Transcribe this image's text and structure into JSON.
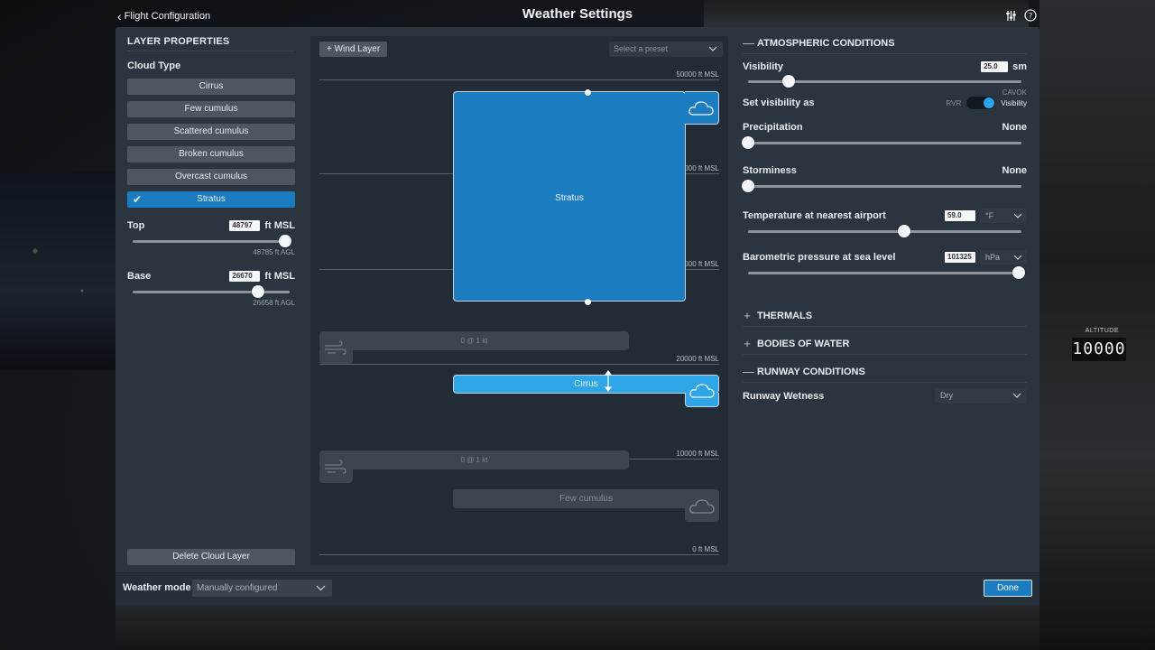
{
  "topbar": {
    "back_label": "Flight Configuration",
    "title": "Weather Settings",
    "icons": [
      "sliders-icon",
      "help-icon"
    ]
  },
  "background": {
    "altitude_label": "ALTITUDE",
    "altitude_value": "10000"
  },
  "layer_properties": {
    "title": "LAYER PROPERTIES",
    "cloud_type_label": "Cloud Type",
    "cloud_types": [
      {
        "label": "Cirrus",
        "selected": false
      },
      {
        "label": "Few cumulus",
        "selected": false
      },
      {
        "label": "Scattered cumulus",
        "selected": false
      },
      {
        "label": "Broken cumulus",
        "selected": false
      },
      {
        "label": "Overcast cumulus",
        "selected": false
      },
      {
        "label": "Stratus",
        "selected": true
      }
    ],
    "top": {
      "label": "Top",
      "value": "48797",
      "unit": "ft MSL",
      "agl": "48785 ft AGL",
      "slider_fraction": 0.97
    },
    "base": {
      "label": "Base",
      "value": "26670",
      "unit": "ft MSL",
      "agl": "26658 ft AGL",
      "slider_fraction": 0.8
    },
    "delete_label": "Delete Cloud Layer"
  },
  "layers_view": {
    "add_wind_label": "+ Wind Layer",
    "preset_placeholder": "Select a preset",
    "altitude_marks": [
      "50000 ft MSL",
      "40000 ft MSL",
      "30000 ft MSL",
      "20000 ft MSL",
      "10000 ft MSL",
      "0 ft MSL"
    ],
    "cloud_layers": [
      {
        "label": "Stratus",
        "state": "selected"
      },
      {
        "label": "Cirrus",
        "state": "active"
      },
      {
        "label": "Few cumulus",
        "state": "inactive"
      }
    ],
    "wind_layers": [
      {
        "label": "0 @ 1 kt"
      },
      {
        "label": "0 @ 1 kt"
      }
    ]
  },
  "atmospheric": {
    "title": "ATMOSPHERIC CONDITIONS",
    "visibility": {
      "label": "Visibility",
      "value": "25.0",
      "unit": "sm",
      "slider_fraction": 0.15,
      "max_label": "CAVOK"
    },
    "visibility_as": {
      "label": "Set visibility as",
      "off_label": "RVR",
      "on_label": "Visibility",
      "on": true
    },
    "precipitation": {
      "label": "Precipitation",
      "value_text": "None",
      "slider_fraction": 0.0
    },
    "storminess": {
      "label": "Storminess",
      "value_text": "None",
      "slider_fraction": 0.0
    },
    "temperature": {
      "label": "Temperature at nearest airport",
      "value": "59.0",
      "unit": "°F",
      "slider_fraction": 0.57
    },
    "pressure": {
      "label": "Barometric pressure at sea level",
      "value": "101325",
      "unit": "hPa",
      "slider_fraction": 0.99
    }
  },
  "sections": {
    "thermals": "THERMALS",
    "bodies_of_water": "BODIES OF WATER",
    "runway_conditions": "RUNWAY CONDITIONS"
  },
  "runway": {
    "wetness_label": "Runway Wetness",
    "wetness_value": "Dry"
  },
  "footer": {
    "weather_mode_label": "Weather mode",
    "weather_mode_value": "Manually configured",
    "done_label": "Done"
  },
  "colors": {
    "accent": "#1c7cc0",
    "active_layer": "#2ea5e6",
    "panel": "#2a3540",
    "panel_dark": "#222c36"
  }
}
